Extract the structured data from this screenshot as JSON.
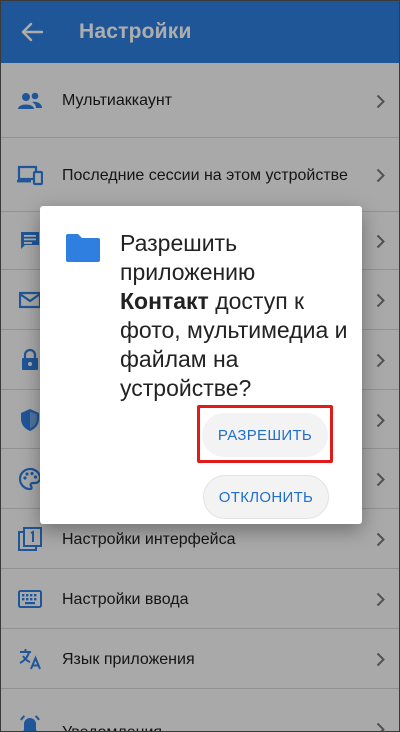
{
  "appbar": {
    "title": "Настройки",
    "back_icon": "arrow-left-icon"
  },
  "accent": "#2f7fe0",
  "list": {
    "items": [
      {
        "label": "Мультиаккаунт",
        "icon": "people-icon"
      },
      {
        "label": "Последние сессии на этом устройстве",
        "icon": "devices-icon"
      },
      {
        "label": "",
        "icon": "message-icon"
      },
      {
        "label": "",
        "icon": "mail-icon"
      },
      {
        "label": "",
        "icon": "lock-icon"
      },
      {
        "label": "",
        "icon": "shield-icon"
      },
      {
        "label": "",
        "icon": "palette-icon"
      },
      {
        "label": "Настройки интерфейса",
        "icon": "interface-icon"
      },
      {
        "label": "Настройки ввода",
        "icon": "keyboard-icon"
      },
      {
        "label": "Язык приложения",
        "icon": "translate-icon"
      },
      {
        "label": "Уведомления",
        "icon": "notifications-icon"
      }
    ]
  },
  "dialog": {
    "message_before": "Разрешить приложению ",
    "app_name": "Контакт",
    "message_after": " доступ к фото, мультимедиа и файлам на устройстве?",
    "allow_label": "РАЗРЕШИТЬ",
    "deny_label": "ОТКЛОНИТЬ",
    "highlight_color": "#e21a1a"
  }
}
